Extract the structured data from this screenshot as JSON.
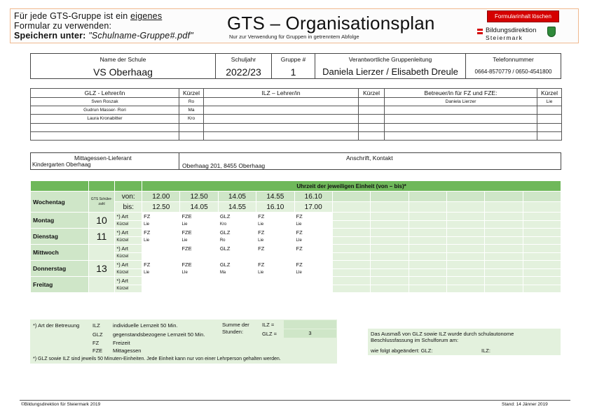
{
  "header": {
    "instruction_line1_pre": "Für jede GTS-Gruppe ist ein ",
    "instruction_line1_under": "eigenes",
    "instruction_line2": "Formular zu verwenden:",
    "instruction_line3_bold": "Speichern unter:",
    "instruction_line3_italic": "\"Schulname-Gruppe#.pdf\"",
    "title": "GTS – Organisationsplan",
    "subtitle": "Nur zur Verwendung für Gruppen in getrenntem Abfolge",
    "clear_button": "Formularinhalt löschen",
    "logo_line1": "Bildungsdirektion",
    "logo_line2": "Steiermark",
    "colors": {
      "accent_red": "#d50000",
      "green_header": "#6fb85a",
      "green_light": "#cfe6c8",
      "green_pale": "#e3f1dd"
    }
  },
  "info": {
    "school_label": "Name der Schule",
    "school": "VS Oberhaag",
    "year_label": "Schuljahr",
    "year": "2022/23",
    "group_label": "Gruppe #",
    "group": "1",
    "lead_label": "Verantwortliche Gruppenleitung",
    "lead": "Daniela Lierzer / Elisabeth Dreule",
    "phone_label": "Telefonnummer",
    "phone": "0664-8570779  / 0650-4541800"
  },
  "staff": {
    "headers": [
      "GLZ - Lehrer/in",
      "Kürzel",
      "ILZ – Lehrer/in",
      "Kürzel",
      "Betreuer/in für FZ und FZE:",
      "Kürzel"
    ],
    "rows": [
      [
        "Sven Roszak",
        "Ro",
        "",
        "",
        "Daniela Lierzer",
        "Lie"
      ],
      [
        "Gudrun Masser- Rori",
        "Ma",
        "",
        "",
        "",
        ""
      ],
      [
        "Laura Kronabitter",
        "Kro",
        "",
        "",
        "",
        ""
      ],
      [
        "",
        "",
        "",
        "",
        "",
        ""
      ],
      [
        "",
        "",
        "",
        "",
        "",
        ""
      ]
    ]
  },
  "lieferant": {
    "label": "Mittagessen-Lieferant",
    "value": "Kindergarten Oberhaag",
    "contact_label": "Anschrift, Kontakt",
    "contact": "Oberhaag 201, 8455 Oberhaag"
  },
  "schedule": {
    "header_title": "Uhrzeit der jeweiligen Einheit (von – bis)*",
    "weekday_label": "Wochentag",
    "gts_label": "GTS Schüler-zahl",
    "from_label": "von:",
    "to_label": "bis:",
    "from_times": [
      "12.00",
      "12.50",
      "14.05",
      "14.55",
      "16.10",
      "",
      "",
      "",
      "",
      "",
      ""
    ],
    "to_times": [
      "12.50",
      "14.05",
      "14.55",
      "16.10",
      "17.00",
      "",
      "",
      "",
      "",
      "",
      ""
    ],
    "art_label": "*) Art",
    "kuerzel_label": "Kürzel",
    "days": [
      {
        "name": "Montag",
        "count": "10",
        "art": [
          "FZ",
          "FZE",
          "GLZ",
          "FZ",
          "FZ"
        ],
        "krz": [
          "Lie",
          "Lie",
          "Kro",
          "Lie",
          "Lie"
        ]
      },
      {
        "name": "Dienstag",
        "count": "11",
        "art": [
          "FZ",
          "FZE",
          "GLZ",
          "FZ",
          "FZ"
        ],
        "krz": [
          "Lie",
          "Lie",
          "Ro",
          "Lie",
          "LIe"
        ]
      },
      {
        "name": "Mittwoch",
        "count": "",
        "art": [
          "",
          "FZE",
          "GLZ",
          "FZ",
          "FZ"
        ],
        "krz": [
          "",
          "",
          "",
          "",
          ""
        ]
      },
      {
        "name": "Donnerstag",
        "count": "13",
        "art": [
          "FZ",
          "FZE",
          "GLZ",
          "FZ",
          "FZ"
        ],
        "krz": [
          "Lie",
          "LIe",
          "Ma",
          "Lie",
          "LIe"
        ]
      },
      {
        "name": "Freitag",
        "count": "",
        "art": [
          "",
          "",
          "",
          "",
          ""
        ],
        "krz": [
          "",
          "",
          "",
          "",
          ""
        ]
      }
    ]
  },
  "legend": {
    "title": "*) Art der Betreuung",
    "items": [
      {
        "code": "ILZ",
        "text": "individuelle Lernzeit 50 Min."
      },
      {
        "code": "GLZ",
        "text": "gegenstandsbezogene Lernzeit 50 Min."
      },
      {
        "code": "FZ",
        "text": "Freizeit"
      },
      {
        "code": "FZE",
        "text": "Mittagessen"
      }
    ],
    "sum_label": "Summe der Stunden:",
    "ilz_label": "ILZ =",
    "ilz_value": "",
    "glz_label": "GLZ =",
    "glz_value": "3",
    "note": "*) GLZ sowie ILZ sind jeweils 50 Minuten-Einheiten. Jede Einheit kann nur von einer Lehrperson gehalten werden."
  },
  "note_box": {
    "line1": "Das Ausmaß von GLZ sowie ILZ wurde durch schulautonome",
    "line2": "Beschlussfassung im Schulforum am:",
    "line3": "wie folgt abgeändert: GLZ:",
    "ilz": "ILZ:"
  },
  "footer": {
    "left": "©Bildungsdirektion für Steiermark 2019",
    "right": "Stand: 14 Jänner 2019"
  }
}
